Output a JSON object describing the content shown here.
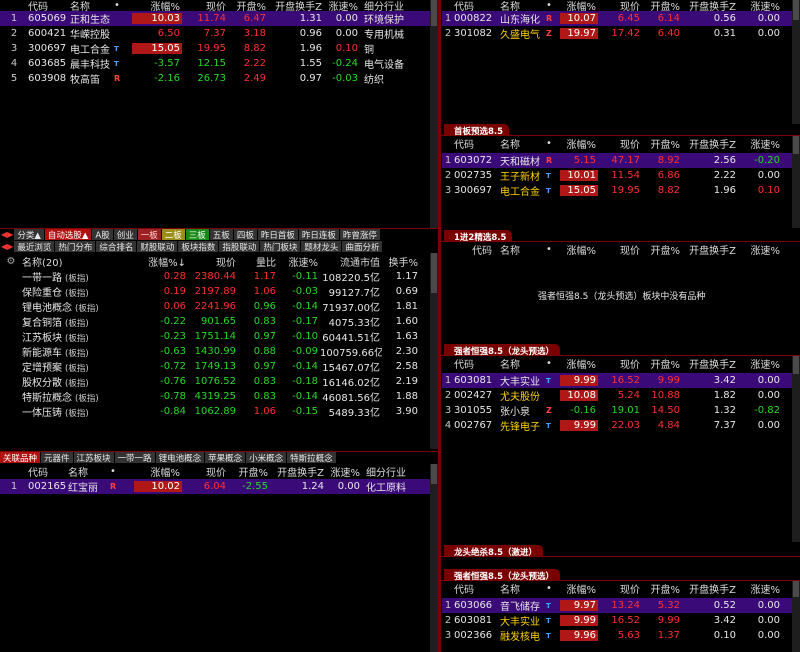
{
  "tl": {
    "headers": [
      "代码",
      "名称",
      "•",
      "涨幅%",
      "现价",
      "开盘%",
      "开盘换手Z",
      "涨速%",
      "细分行业"
    ],
    "rows": [
      {
        "n": "1",
        "code": "605069",
        "name": "正和生态",
        "tag": "",
        "pct": "10.03",
        "price": "11.74",
        "open": "6.47",
        "turn": "1.31",
        "speed": "0.00",
        "ind": "环境保护",
        "sel": true
      },
      {
        "n": "2",
        "code": "600421",
        "name": "华嵘控股",
        "tag": "",
        "pct": "6.50",
        "price": "7.37",
        "open": "3.18",
        "turn": "0.96",
        "speed": "0.00",
        "ind": "专用机械"
      },
      {
        "n": "3",
        "code": "300697",
        "name": "电工合金",
        "tag": "T",
        "pct": "15.05",
        "price": "19.95",
        "open": "8.82",
        "turn": "1.96",
        "speed": "0.10",
        "ind": "铜"
      },
      {
        "n": "4",
        "code": "603685",
        "name": "晨丰科技",
        "tag": "T",
        "pct": "-3.57",
        "price": "12.15",
        "open": "2.22",
        "turn": "1.55",
        "speed": "-0.24",
        "ind": "电气设备"
      },
      {
        "n": "5",
        "code": "603908",
        "name": "牧高笛",
        "tag": "R",
        "pct": "-2.16",
        "price": "26.73",
        "open": "2.49",
        "turn": "0.97",
        "speed": "-0.03",
        "ind": "纺织"
      }
    ]
  },
  "tr": {
    "headers": [
      "代码",
      "名称",
      "•",
      "涨幅%",
      "现价",
      "开盘%",
      "开盘换手Z",
      "涨速%"
    ],
    "rows": [
      {
        "n": "1",
        "code": "000822",
        "name": "山东海化",
        "tag": "R",
        "pct": "10.07",
        "price": "6.45",
        "open": "6.14",
        "turn": "0.56",
        "speed": "0.00",
        "sel": true
      },
      {
        "n": "2",
        "code": "301082",
        "name": "久盛电气",
        "tag": "Z",
        "pct": "19.97",
        "price": "17.42",
        "open": "6.40",
        "turn": "0.31",
        "speed": "0.00"
      }
    ]
  },
  "p2": {
    "title": "首板预选8.5",
    "headers": [
      "代码",
      "名称",
      "•",
      "涨幅%",
      "现价",
      "开盘%",
      "开盘换手Z",
      "涨速%"
    ],
    "rows": [
      {
        "n": "1",
        "code": "603072",
        "name": "天和磁材",
        "tag": "R",
        "pct": "5.15",
        "price": "47.17",
        "open": "8.92",
        "turn": "2.56",
        "speed": "-0.20",
        "sel": true
      },
      {
        "n": "2",
        "code": "002735",
        "name": "王子新材",
        "tag": "T",
        "pct": "10.01",
        "price": "11.54",
        "open": "6.86",
        "turn": "2.22",
        "speed": "0.00"
      },
      {
        "n": "3",
        "code": "300697",
        "name": "电工合金",
        "tag": "T",
        "pct": "15.05",
        "price": "19.95",
        "open": "8.82",
        "turn": "1.96",
        "speed": "0.10"
      }
    ]
  },
  "p3": {
    "title": "1进2精选8.5",
    "headers": [
      "代码",
      "名称",
      "•",
      "涨幅%",
      "现价",
      "开盘%",
      "开盘换手Z",
      "涨速%"
    ],
    "message": "强者恒强8.5（龙头预选）板块中没有品种"
  },
  "p4": {
    "title": "强者恒强8.5（龙头预选）",
    "headers": [
      "代码",
      "名称",
      "•",
      "涨幅%",
      "现价",
      "开盘%",
      "开盘换手Z",
      "涨速%"
    ],
    "rows": [
      {
        "n": "1",
        "code": "603081",
        "name": "大丰实业",
        "tag": "T",
        "pct": "9.99",
        "price": "16.52",
        "open": "9.99",
        "turn": "3.42",
        "speed": "0.00",
        "sel": true
      },
      {
        "n": "2",
        "code": "002427",
        "name": "尤夫股份",
        "tag": "",
        "pct": "10.08",
        "price": "5.24",
        "open": "10.88",
        "turn": "1.82",
        "speed": "0.00"
      },
      {
        "n": "3",
        "code": "301055",
        "name": "张小泉",
        "tag": "Z",
        "pct": "-0.16",
        "price": "19.01",
        "open": "14.50",
        "turn": "1.32",
        "speed": "-0.82"
      },
      {
        "n": "4",
        "code": "002767",
        "name": "先锋电子",
        "tag": "T",
        "pct": "9.99",
        "price": "22.03",
        "open": "4.84",
        "turn": "7.37",
        "speed": "0.00"
      }
    ]
  },
  "p5": {
    "title": "龙头绝杀8.5（激进）"
  },
  "p6": {
    "title": "强者恒强8.5（龙头预选）",
    "headers": [
      "代码",
      "名称",
      "•",
      "涨幅%",
      "现价",
      "开盘%",
      "开盘换手Z",
      "涨速%"
    ],
    "rows": [
      {
        "n": "1",
        "code": "603066",
        "name": "音飞储存",
        "tag": "T",
        "pct": "9.97",
        "price": "13.24",
        "open": "5.32",
        "turn": "0.52",
        "speed": "0.00",
        "sel": true
      },
      {
        "n": "2",
        "code": "603081",
        "name": "大丰实业",
        "tag": "T",
        "pct": "9.99",
        "price": "16.52",
        "open": "9.99",
        "turn": "3.42",
        "speed": "0.00"
      },
      {
        "n": "3",
        "code": "002366",
        "name": "融发核电",
        "tag": "T",
        "pct": "9.96",
        "price": "5.63",
        "open": "1.37",
        "turn": "0.10",
        "speed": "0.00"
      }
    ]
  },
  "tabs1": [
    "分类▲",
    "自动选股▲",
    "A股",
    "创业",
    "一板",
    "二板",
    "三板",
    "五板",
    "四板",
    "昨日首板",
    "昨日连板",
    "昨曾涨停"
  ],
  "tabs2": [
    "最近浏览",
    "热门分布",
    "综合排名",
    "财股联动",
    "板块指数",
    "指股联动",
    "热门板块",
    "题材龙头",
    "曲面分析"
  ],
  "sector": {
    "headers": [
      "名称(20)",
      "涨幅%↓",
      "现价",
      "量比",
      "涨速%",
      "流通市值",
      "换手%"
    ],
    "rows": [
      {
        "name": "一带一路",
        "tag": "(板指)",
        "pct": "0.28",
        "price": "2380.44",
        "vol": "1.17",
        "speed": "-0.11",
        "cap": "108220.5亿",
        "turn": "1.17"
      },
      {
        "name": "保险重仓",
        "tag": "(板指)",
        "pct": "0.19",
        "price": "2197.89",
        "vol": "1.06",
        "speed": "-0.03",
        "cap": "99127.7亿",
        "turn": "0.69"
      },
      {
        "name": "锂电池概念",
        "tag": "(板指)",
        "pct": "0.06",
        "price": "2241.96",
        "vol": "0.96",
        "speed": "-0.14",
        "cap": "71937.00亿",
        "turn": "1.81"
      },
      {
        "name": "复合铜箔",
        "tag": "(板指)",
        "pct": "-0.22",
        "price": "901.65",
        "vol": "0.83",
        "speed": "-0.17",
        "cap": "4075.33亿",
        "turn": "1.60"
      },
      {
        "name": "江苏板块",
        "tag": "(板指)",
        "pct": "-0.23",
        "price": "1751.14",
        "vol": "0.97",
        "speed": "-0.10",
        "cap": "60441.51亿",
        "turn": "1.63"
      },
      {
        "name": "新能源车",
        "tag": "(板指)",
        "pct": "-0.63",
        "price": "1430.99",
        "vol": "0.88",
        "speed": "-0.09",
        "cap": "100759.66亿",
        "turn": "2.30"
      },
      {
        "name": "定增预案",
        "tag": "(板指)",
        "pct": "-0.72",
        "price": "1749.13",
        "vol": "0.97",
        "speed": "-0.14",
        "cap": "15467.07亿",
        "turn": "2.58"
      },
      {
        "name": "股权分散",
        "tag": "(板指)",
        "pct": "-0.76",
        "price": "1076.52",
        "vol": "0.83",
        "speed": "-0.18",
        "cap": "16146.02亿",
        "turn": "2.19"
      },
      {
        "name": "特斯拉概念",
        "tag": "(板指)",
        "pct": "-0.78",
        "price": "4319.25",
        "vol": "0.83",
        "speed": "-0.14",
        "cap": "46081.56亿",
        "turn": "1.88"
      },
      {
        "name": "一体压铸",
        "tag": "(板指)",
        "pct": "-0.84",
        "price": "1062.89",
        "vol": "1.06",
        "speed": "-0.15",
        "cap": "5489.33亿",
        "turn": "3.90"
      }
    ]
  },
  "tabs3": [
    "关联品种",
    "元器件",
    "江苏板块",
    "一带一路",
    "锂电池概念",
    "苹果概念",
    "小米概念",
    "特斯拉概念"
  ],
  "assoc": {
    "headers": [
      "代码",
      "名称",
      "•",
      "涨幅%",
      "现价",
      "开盘%",
      "开盘换手Z",
      "涨速%",
      "细分行业"
    ],
    "rows": [
      {
        "n": "1",
        "code": "002165",
        "name": "红宝丽",
        "tag": "R",
        "pct": "10.02",
        "price": "6.04",
        "open": "-2.55",
        "turn": "1.24",
        "speed": "0.00",
        "ind": "化工原料",
        "sel": true
      }
    ]
  }
}
